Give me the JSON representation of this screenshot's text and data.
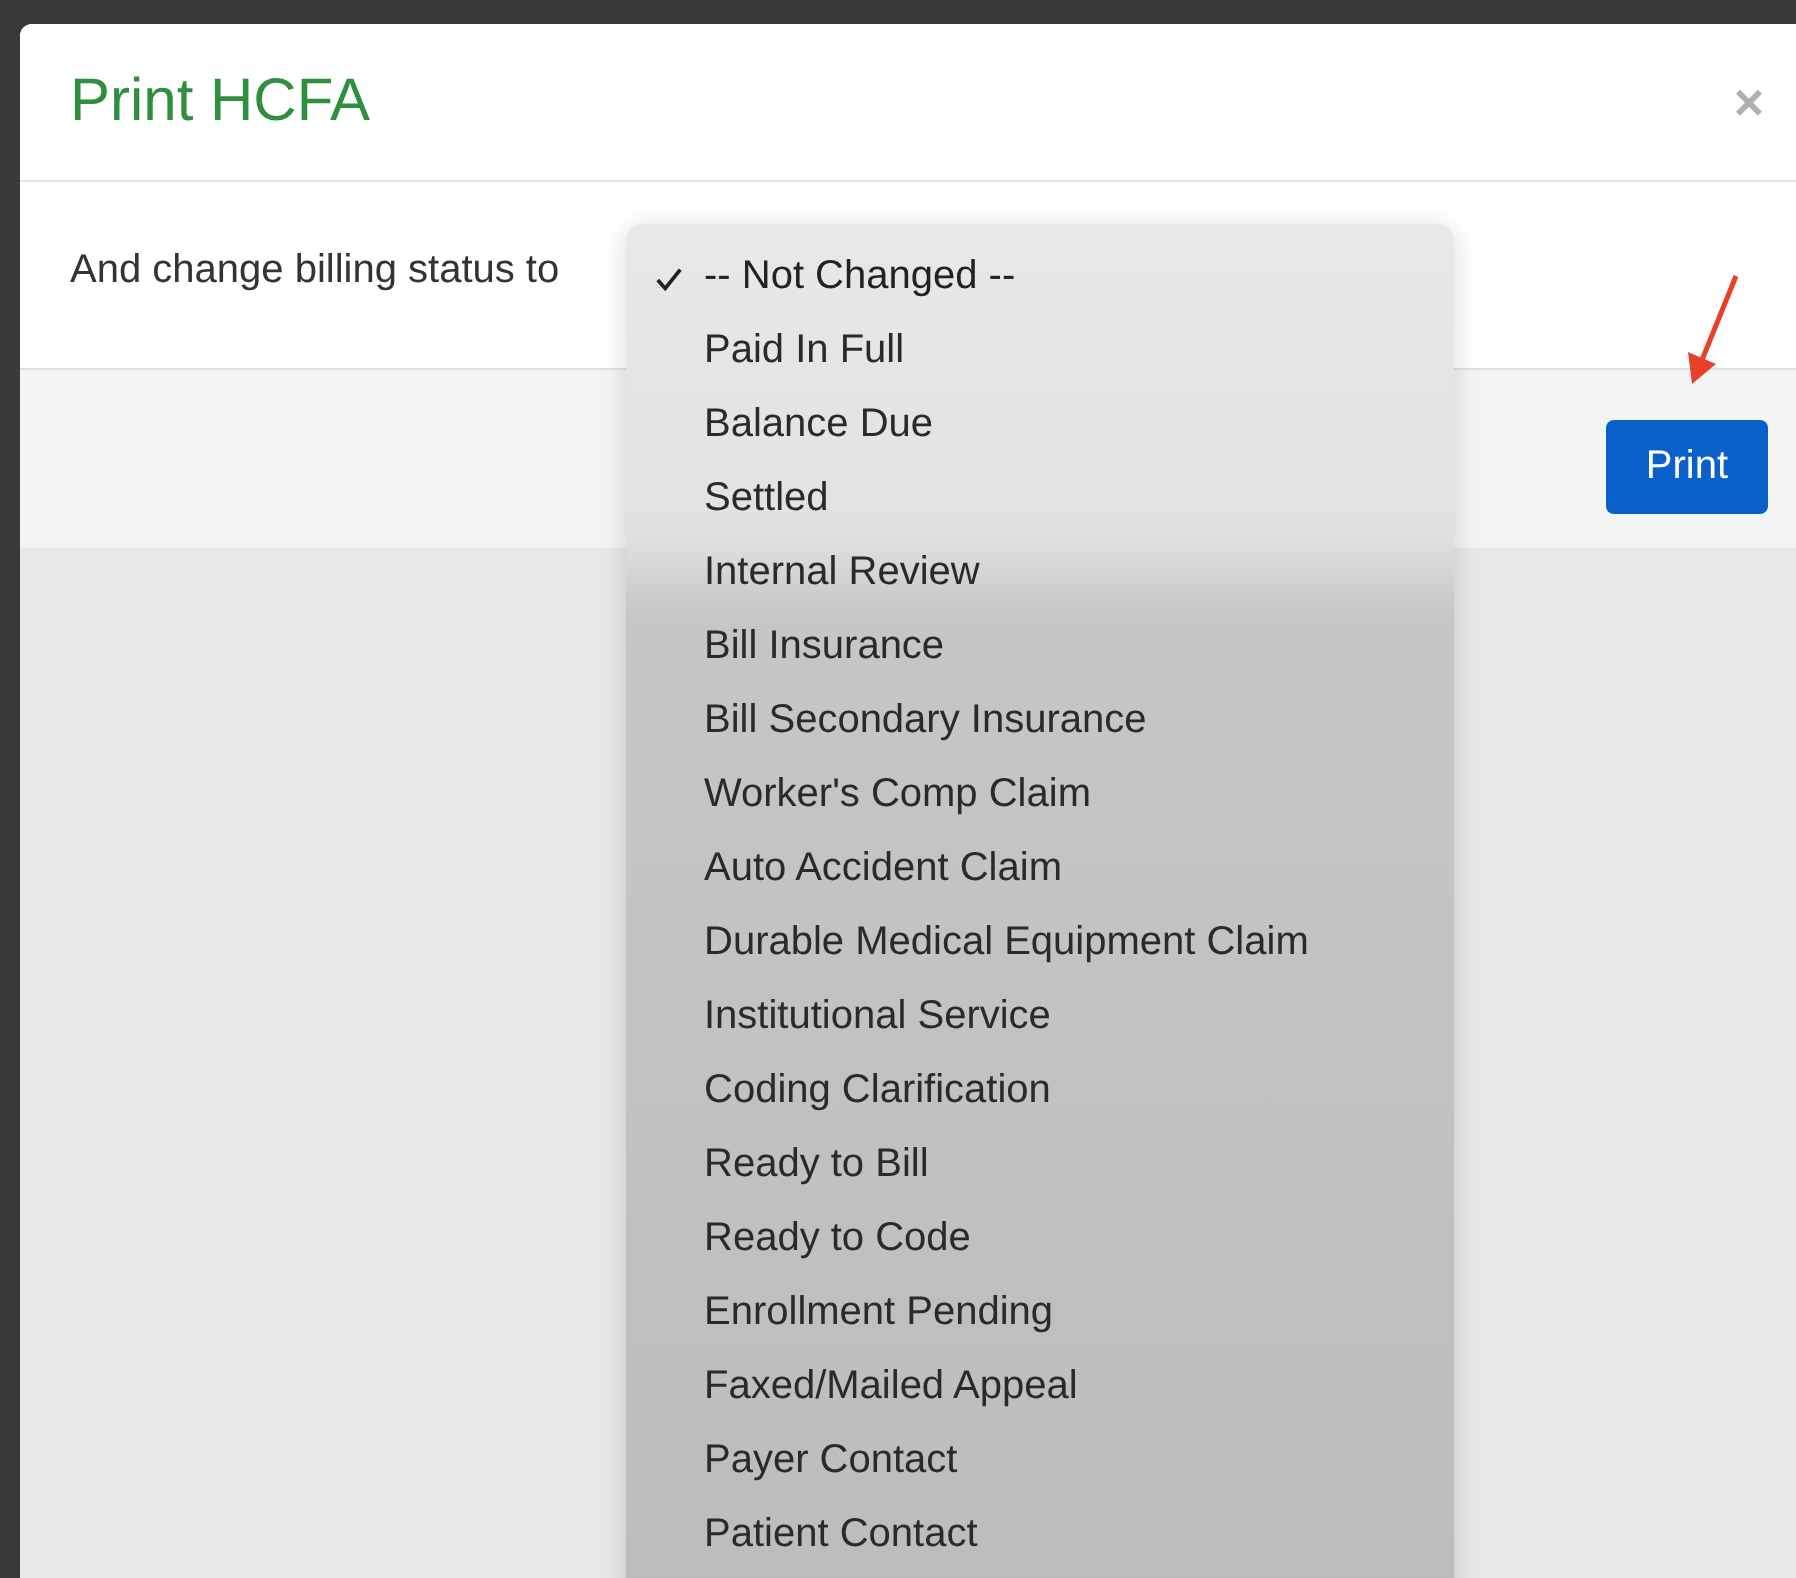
{
  "dialog": {
    "title": "Print HCFA",
    "close": "×"
  },
  "billing_status": {
    "label": "And change billing status to",
    "options": [
      {
        "label": "-- Not Changed --",
        "selected": true
      },
      {
        "label": "Paid In Full",
        "selected": false
      },
      {
        "label": "Balance Due",
        "selected": false
      },
      {
        "label": "Settled",
        "selected": false
      },
      {
        "label": "Internal Review",
        "selected": false
      },
      {
        "label": "Bill Insurance",
        "selected": false
      },
      {
        "label": "Bill Secondary Insurance",
        "selected": false
      },
      {
        "label": "Worker's Comp Claim",
        "selected": false
      },
      {
        "label": "Auto Accident Claim",
        "selected": false
      },
      {
        "label": "Durable Medical Equipment Claim",
        "selected": false
      },
      {
        "label": "Institutional Service",
        "selected": false
      },
      {
        "label": "Coding Clarification",
        "selected": false
      },
      {
        "label": "Ready to Bill",
        "selected": false
      },
      {
        "label": "Ready to Code",
        "selected": false
      },
      {
        "label": "Enrollment Pending",
        "selected": false
      },
      {
        "label": "Faxed/Mailed Appeal",
        "selected": false
      },
      {
        "label": "Payer Contact",
        "selected": false
      },
      {
        "label": "Patient Contact",
        "selected": false
      }
    ]
  },
  "footer": {
    "button": "Print"
  }
}
